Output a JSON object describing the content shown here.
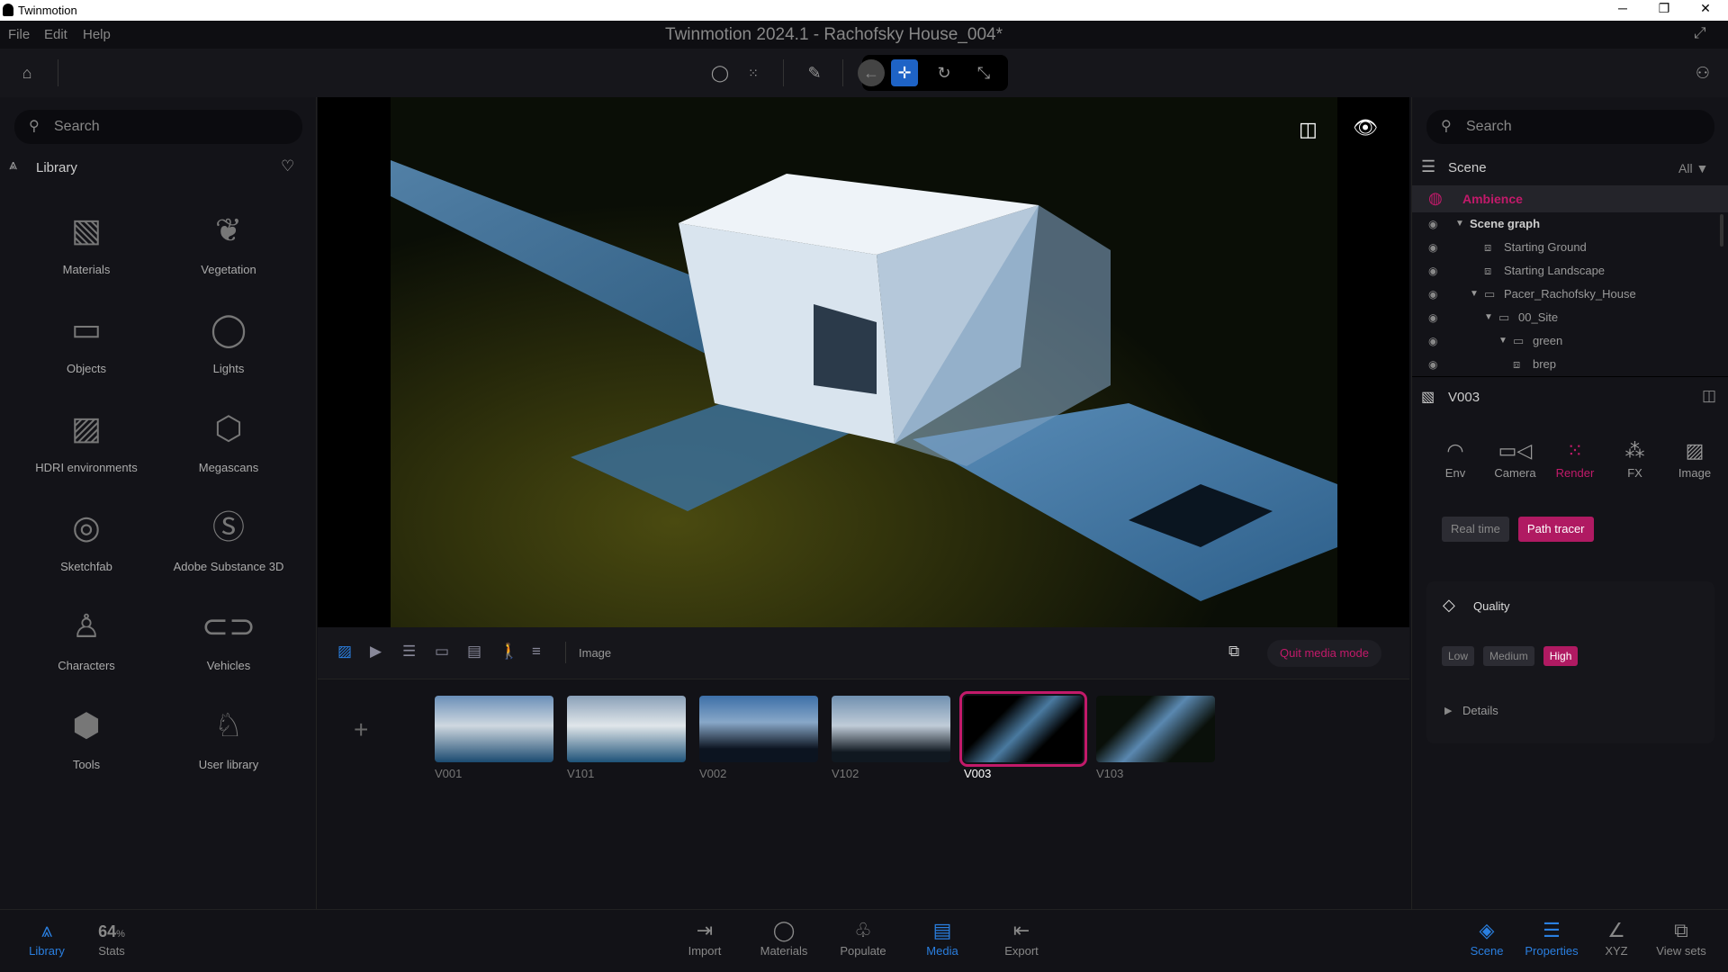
{
  "window": {
    "app_name": "Twinmotion",
    "title": "Twinmotion 2024.1 - Rachofsky House_004*"
  },
  "menu": [
    "File",
    "Edit",
    "Help"
  ],
  "left": {
    "search_placeholder": "Search",
    "library_label": "Library",
    "items": [
      {
        "label": "Materials",
        "icon": "materials-icon",
        "glyph": "▧"
      },
      {
        "label": "Vegetation",
        "icon": "tree-icon",
        "glyph": "❦"
      },
      {
        "label": "Objects",
        "icon": "sofa-icon",
        "glyph": "▭"
      },
      {
        "label": "Lights",
        "icon": "bulb-icon",
        "glyph": "◯"
      },
      {
        "label": "HDRI environments",
        "icon": "hdri-icon",
        "glyph": "▨"
      },
      {
        "label": "Megascans",
        "icon": "megascans-icon",
        "glyph": "⬡"
      },
      {
        "label": "Sketchfab",
        "icon": "sketchfab-icon",
        "glyph": "◎"
      },
      {
        "label": "Adobe Substance 3D",
        "icon": "substance-icon",
        "glyph": "Ⓢ"
      },
      {
        "label": "Characters",
        "icon": "character-icon",
        "glyph": "♙"
      },
      {
        "label": "Vehicles",
        "icon": "car-icon",
        "glyph": "⊂⊃"
      },
      {
        "label": "Tools",
        "icon": "tools-icon",
        "glyph": "⬢"
      },
      {
        "label": "User library",
        "icon": "user-library-icon",
        "glyph": "♘"
      }
    ]
  },
  "media": {
    "mode_label": "Image",
    "quit_label": "Quit media mode",
    "thumbs": [
      {
        "label": "V001"
      },
      {
        "label": "V101"
      },
      {
        "label": "V002"
      },
      {
        "label": "V102"
      },
      {
        "label": "V003",
        "selected": true
      },
      {
        "label": "V103"
      }
    ]
  },
  "right": {
    "search_placeholder": "Search",
    "scene_label": "Scene",
    "filter": "All",
    "ambience": "Ambience",
    "tree": [
      {
        "label": "Scene graph",
        "depth": 0,
        "arrow": true,
        "bold": true
      },
      {
        "label": "Starting Ground",
        "depth": 2
      },
      {
        "label": "Starting Landscape",
        "depth": 2
      },
      {
        "label": "Pacer_Rachofsky_House",
        "depth": 1,
        "arrow": true,
        "folder": true
      },
      {
        "label": "00_Site",
        "depth": 2,
        "arrow": true,
        "folder": true
      },
      {
        "label": "green",
        "depth": 3,
        "arrow": true,
        "folder": true
      },
      {
        "label": "brep",
        "depth": 4
      }
    ],
    "view_name": "V003",
    "tabs": [
      {
        "label": "Env",
        "glyph": "◠"
      },
      {
        "label": "Camera",
        "glyph": "▭◁"
      },
      {
        "label": "Render",
        "glyph": "⁙",
        "active": true
      },
      {
        "label": "FX",
        "glyph": "⁂"
      },
      {
        "label": "Image",
        "glyph": "▨"
      }
    ],
    "render_modes": [
      {
        "label": "Real time"
      },
      {
        "label": "Path tracer",
        "active": true
      }
    ],
    "quality_label": "Quality",
    "quality": [
      {
        "label": "Low"
      },
      {
        "label": "Medium"
      },
      {
        "label": "High",
        "active": true
      }
    ],
    "details_label": "Details"
  },
  "bottom": {
    "left": [
      {
        "label": "Library",
        "active": true,
        "glyph": "⩓"
      },
      {
        "label": "Stats",
        "value": "64",
        "unit": "%"
      }
    ],
    "center": [
      {
        "label": "Import",
        "glyph": "⇥"
      },
      {
        "label": "Materials",
        "glyph": "◯"
      },
      {
        "label": "Populate",
        "glyph": "♧"
      },
      {
        "label": "Media",
        "active": true,
        "glyph": "▤"
      },
      {
        "label": "Export",
        "glyph": "⇤"
      }
    ],
    "right": [
      {
        "label": "Scene",
        "active": true,
        "glyph": "◈"
      },
      {
        "label": "Properties",
        "active": true,
        "glyph": "☰"
      },
      {
        "label": "XYZ",
        "glyph": "∠"
      },
      {
        "label": "View sets",
        "glyph": "⧉"
      }
    ]
  },
  "colors": {
    "accent": "#c21a6a",
    "blue": "#2a7fe0"
  }
}
